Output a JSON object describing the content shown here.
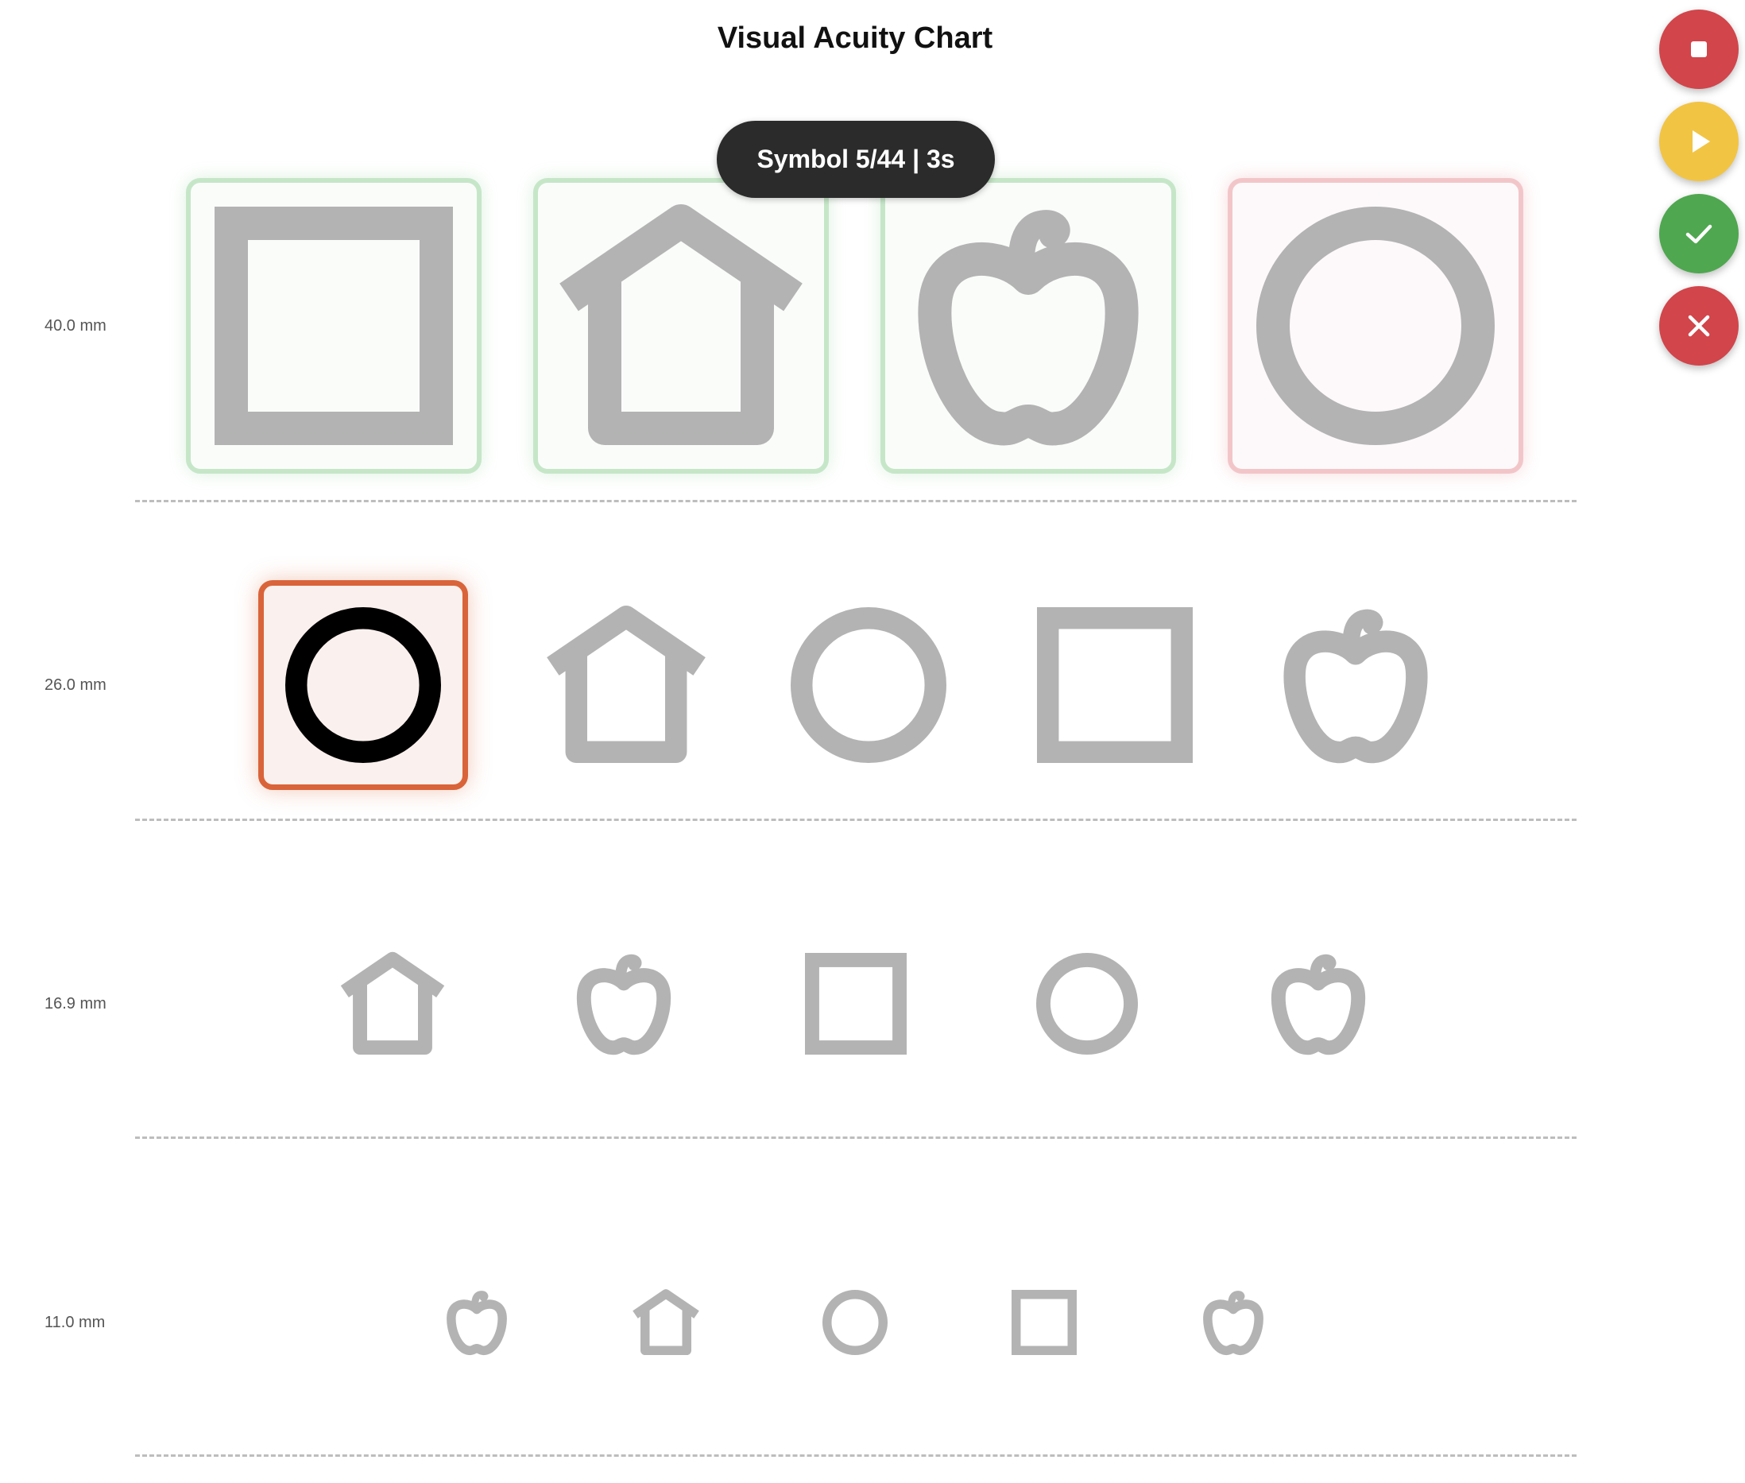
{
  "title": "Visual Acuity Chart",
  "status": "Symbol 5/44 | 3s",
  "controls": [
    {
      "name": "stop-button",
      "icon": "stop-icon",
      "color": "#d1454b"
    },
    {
      "name": "play-button",
      "icon": "play-icon",
      "color": "#f2c443"
    },
    {
      "name": "correct-button",
      "icon": "check-icon",
      "color": "#4fa750"
    },
    {
      "name": "incorrect-button",
      "icon": "close-icon",
      "color": "#d1454b"
    }
  ],
  "colors": {
    "symbol_inactive": "#b3b3b3",
    "symbol_active": "#000000",
    "correct": "#c6e6c8",
    "incorrect": "#f2c6c9",
    "current": "#d9643a"
  },
  "rows": [
    {
      "label": "40.0 mm",
      "symbols": [
        {
          "shape": "square",
          "state": "correct"
        },
        {
          "shape": "house",
          "state": "correct"
        },
        {
          "shape": "apple",
          "state": "correct"
        },
        {
          "shape": "circle",
          "state": "incorrect"
        }
      ]
    },
    {
      "label": "26.0 mm",
      "symbols": [
        {
          "shape": "circle",
          "state": "current"
        },
        {
          "shape": "house",
          "state": "pending"
        },
        {
          "shape": "circle",
          "state": "pending"
        },
        {
          "shape": "square",
          "state": "pending"
        },
        {
          "shape": "apple",
          "state": "pending"
        }
      ]
    },
    {
      "label": "16.9 mm",
      "symbols": [
        {
          "shape": "house",
          "state": "pending"
        },
        {
          "shape": "apple",
          "state": "pending"
        },
        {
          "shape": "square",
          "state": "pending"
        },
        {
          "shape": "circle",
          "state": "pending"
        },
        {
          "shape": "apple",
          "state": "pending"
        }
      ]
    },
    {
      "label": "11.0 mm",
      "symbols": [
        {
          "shape": "apple",
          "state": "pending"
        },
        {
          "shape": "house",
          "state": "pending"
        },
        {
          "shape": "circle",
          "state": "pending"
        },
        {
          "shape": "square",
          "state": "pending"
        },
        {
          "shape": "apple",
          "state": "pending"
        }
      ]
    }
  ]
}
